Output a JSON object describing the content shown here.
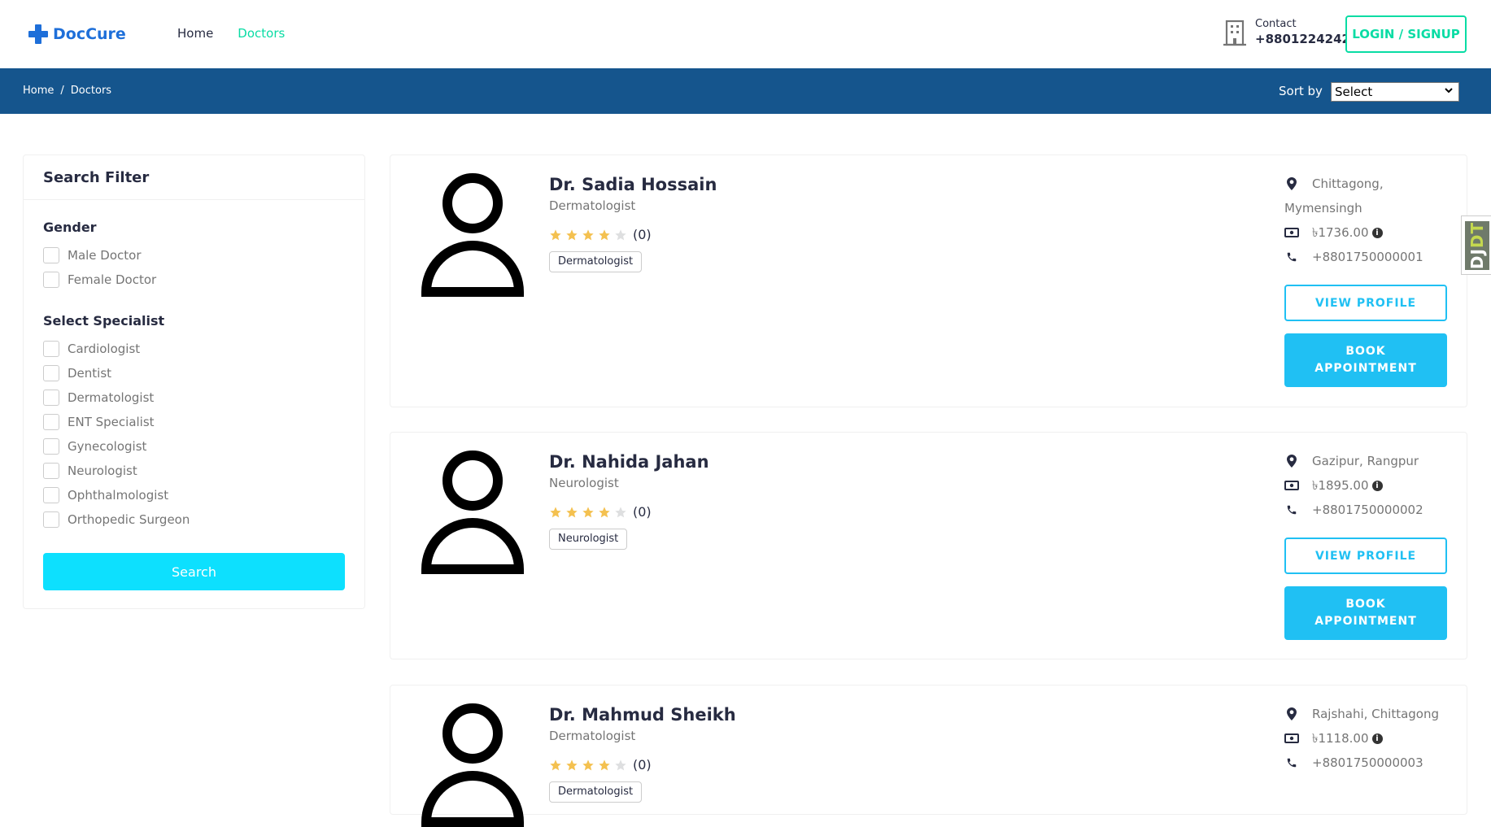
{
  "header": {
    "logo_text": "DocCure",
    "nav": [
      {
        "label": "Home",
        "active": false
      },
      {
        "label": "Doctors",
        "active": true
      }
    ],
    "contact_label": "Contact",
    "contact_number": "+8801224242",
    "login_label": "LOGIN / SIGNUP"
  },
  "breadcrumb": {
    "home": "Home",
    "separator": "/",
    "current": "Doctors",
    "sort_label": "Sort by",
    "sort_value": "Select"
  },
  "filter": {
    "title": "Search Filter",
    "gender_title": "Gender",
    "gender_options": [
      "Male Doctor",
      "Female Doctor"
    ],
    "specialist_title": "Select Specialist",
    "specialist_options": [
      "Cardiologist",
      "Dentist",
      "Dermatologist",
      "ENT Specialist",
      "Gynecologist",
      "Neurologist",
      "Ophthalmologist",
      "Orthopedic Surgeon"
    ],
    "search_label": "Search"
  },
  "doctors": [
    {
      "name": "Dr. Sadia Hossain",
      "specialty": "Dermatologist",
      "rating": 4,
      "rating_count": "(0)",
      "tag": "Dermatologist",
      "location_line1": "Chittagong,",
      "location_line2": "Mymensingh",
      "fee": "৳1736.00",
      "phone": "+8801750000001"
    },
    {
      "name": "Dr. Nahida Jahan",
      "specialty": "Neurologist",
      "rating": 4,
      "rating_count": "(0)",
      "tag": "Neurologist",
      "location_line1": "Gazipur, Rangpur",
      "location_line2": "",
      "fee": "৳1895.00",
      "phone": "+8801750000002"
    },
    {
      "name": "Dr. Mahmud Sheikh",
      "specialty": "Dermatologist",
      "rating": 4,
      "rating_count": "(0)",
      "tag": "Dermatologist",
      "location_line1": "Rajshahi, Chittagong",
      "location_line2": "",
      "fee": "৳1118.00",
      "phone": "+8801750000003"
    }
  ],
  "buttons": {
    "view_profile": "VIEW PROFILE",
    "book_appointment": "BOOK APPOINTMENT"
  },
  "info_icon_glyph": "i",
  "djdt": {
    "part1": "DJ",
    "part2": "DT"
  },
  "colors": {
    "brand_blue": "#1e6fd9",
    "accent_green": "#09dca4",
    "bar_blue": "#15558d",
    "button_cyan": "#20c0f3",
    "search_cyan": "#0de0fe",
    "star_gold": "#f4c150"
  }
}
